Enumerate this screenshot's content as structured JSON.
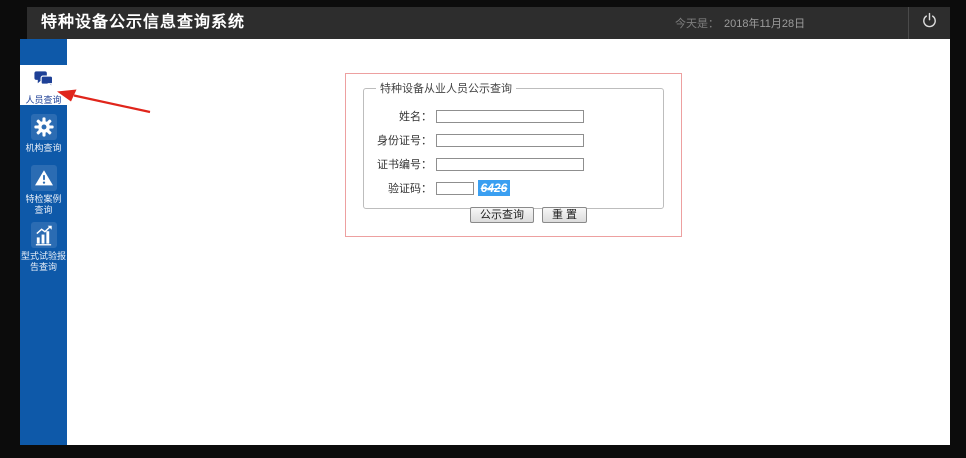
{
  "header": {
    "title": "特种设备公示信息查询系统",
    "date_label": "今天是：",
    "date_value": "2018年11月28日",
    "power_icon": "power-icon"
  },
  "sidebar": {
    "items": [
      {
        "label": "人员查询",
        "icon": "comments-icon",
        "active": true
      },
      {
        "label": "机构查询",
        "icon": "gear-icon",
        "active": false
      },
      {
        "label_line1": "特检案例",
        "label_line2": "查询",
        "icon": "warning-triangle-icon",
        "active": false
      },
      {
        "label_line1": "型式试验报",
        "label_line2": "告查询",
        "icon": "bar-chart-icon",
        "active": false
      }
    ]
  },
  "form": {
    "legend": "特种设备从业人员公示查询",
    "fields": [
      {
        "label": "姓名：",
        "value": ""
      },
      {
        "label": "身份证号：",
        "value": ""
      },
      {
        "label": "证书编号：",
        "value": ""
      },
      {
        "label": "验证码：",
        "value": "",
        "captcha_text": "6426"
      }
    ],
    "buttons": [
      {
        "label": "公示查询"
      },
      {
        "label": "重 置"
      }
    ]
  },
  "annotation": {
    "type": "red-arrow",
    "points_to": "人员查询"
  },
  "colors": {
    "header_bg": "#2d2d2d",
    "sidebar_blue": "#0e59a9",
    "icon_tile_blue": "#2b6cb3",
    "active_item_text": "#1e4096",
    "captcha_bg": "#3a9ff1",
    "highlight_border": "#eda0a0",
    "annotation_red": "#e0251b"
  }
}
